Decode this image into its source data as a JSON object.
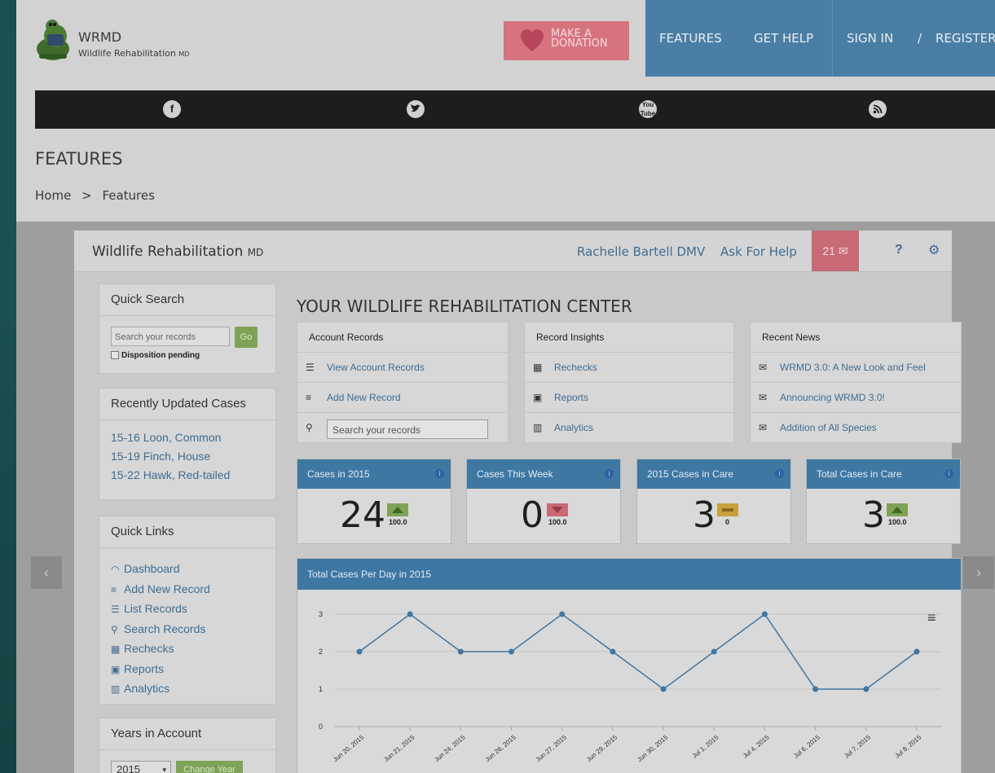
{
  "site": {
    "brand_name": "WRMD",
    "brand_tag": "Wildlife Rehabilitation",
    "brand_tag_suffix": "MD",
    "donate_line1": "MAKE A",
    "donate_line2": "DONATION",
    "nav": [
      "FEATURES",
      "GET HELP",
      "SIGN IN",
      "/",
      "REGISTER"
    ],
    "social": [
      "facebook-icon",
      "twitter-icon",
      "youtube-icon",
      "rss-icon"
    ],
    "page_title": "FEATURES",
    "breadcrumb": [
      "Home",
      ">",
      "Features"
    ],
    "arrow_left": "‹",
    "arrow_right": "›"
  },
  "app": {
    "title": "Wildlife Rehabilitation",
    "title_suffix": "MD",
    "user": "Rachelle Bartell DMV",
    "help": "Ask For Help",
    "mail_count": "21",
    "help_icon": "?",
    "quick_search": {
      "title": "Quick Search",
      "placeholder": "Search your records",
      "go": "Go",
      "disposition": "Disposition pending"
    },
    "recent": {
      "title": "Recently Updated Cases",
      "items": [
        "15-16 Loon, Common",
        "15-19 Finch, House",
        "15-22 Hawk, Red-tailed"
      ]
    },
    "quick_links": {
      "title": "Quick Links",
      "items": [
        "Dashboard",
        "Add New Record",
        "List Records",
        "Search Records",
        "Rechecks",
        "Reports",
        "Analytics"
      ]
    },
    "years": {
      "title": "Years in Account",
      "year": "2015",
      "button": "Change Year"
    },
    "main_title": "YOUR WILDLIFE REHABILITATION CENTER",
    "account_records": {
      "title": "Account Records",
      "items": [
        "View Account Records",
        "Add New Record"
      ],
      "search_placeholder": "Search your records"
    },
    "insights": {
      "title": "Record Insights",
      "items": [
        "Rechecks",
        "Reports",
        "Analytics"
      ]
    },
    "news": {
      "title": "Recent News",
      "items": [
        "WRMD 3.0: A New Look and Feel",
        "Announcing WRMD 3.0!",
        "Addition of All Species"
      ]
    },
    "stats": [
      {
        "title": "Cases in 2015",
        "value": "24",
        "delta": "100.0",
        "trend": "up",
        "color": "#7ea356"
      },
      {
        "title": "Cases This Week",
        "value": "0",
        "delta": "100.0",
        "trend": "down",
        "color": "#c86b76"
      },
      {
        "title": "2015 Cases in Care",
        "value": "3",
        "delta": "0",
        "trend": "flat",
        "color": "#c9a13c"
      },
      {
        "title": "Total Cases in Care",
        "value": "3",
        "delta": "100.0",
        "trend": "up",
        "color": "#7ea356"
      }
    ],
    "chart_title": "Total Cases Per Day in 2015"
  },
  "chart_data": {
    "type": "line",
    "title": "Total Cases Per Day in 2015",
    "categories": [
      "Jun 20, 2015",
      "Jun 21, 2015",
      "Jun 24, 2015",
      "Jun 26, 2015",
      "Jun 27, 2015",
      "Jun 29, 2015",
      "Jun 30, 2015",
      "Jul 1, 2015",
      "Jul 4, 2015",
      "Jul 6, 2015",
      "Jul 7, 2015",
      "Jul 8, 2015"
    ],
    "values": [
      2,
      3,
      2,
      2,
      3,
      2,
      1,
      2,
      3,
      1,
      1,
      2
    ],
    "yticks": [
      "0",
      "1",
      "2",
      "3"
    ],
    "ylim": [
      0,
      3
    ],
    "grid": true,
    "line_color": "#3f77a3"
  }
}
